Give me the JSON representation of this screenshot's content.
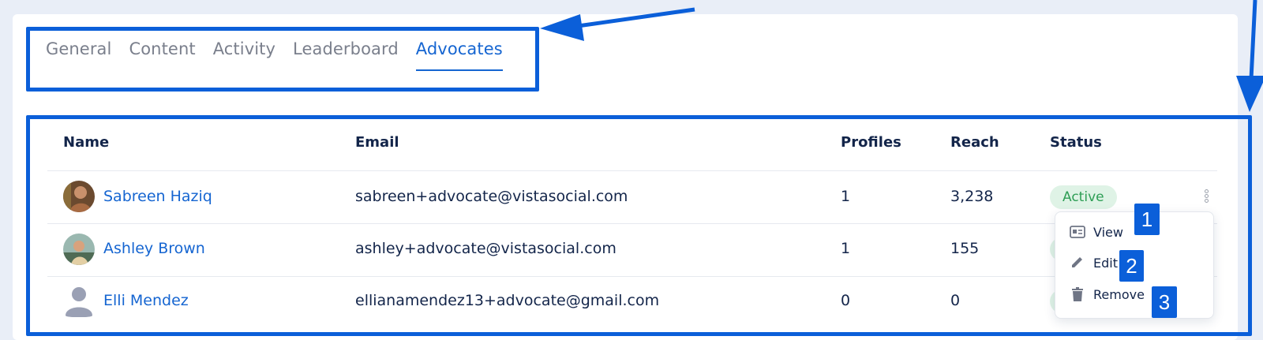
{
  "tabs": [
    {
      "label": "General"
    },
    {
      "label": "Content"
    },
    {
      "label": "Activity"
    },
    {
      "label": "Leaderboard"
    },
    {
      "label": "Advocates",
      "active": true
    }
  ],
  "table": {
    "headers": {
      "name": "Name",
      "email": "Email",
      "profiles": "Profiles",
      "reach": "Reach",
      "status": "Status"
    },
    "rows": [
      {
        "name": "Sabreen Haziq",
        "email": "sabreen+advocate@vistasocial.com",
        "profiles": "1",
        "reach": "3,238",
        "status": "Active",
        "avatar": "photo"
      },
      {
        "name": "Ashley Brown",
        "email": "ashley+advocate@vistasocial.com",
        "profiles": "1",
        "reach": "155",
        "status": "",
        "avatar": "photo"
      },
      {
        "name": "Elli Mendez",
        "email": "ellianamendez13+advocate@gmail.com",
        "profiles": "0",
        "reach": "0",
        "status": "",
        "avatar": "placeholder"
      }
    ]
  },
  "menu": {
    "items": [
      {
        "label": "View",
        "icon": "view-card-icon",
        "step": "1"
      },
      {
        "label": "Edit",
        "icon": "pencil-icon",
        "step": "2"
      },
      {
        "label": "Remove",
        "icon": "trash-icon",
        "step": "3"
      }
    ]
  },
  "colors": {
    "accent": "#0b5fd9",
    "link": "#1565d1",
    "active_badge_bg": "#dff3e6",
    "active_badge_text": "#2e9e55"
  }
}
